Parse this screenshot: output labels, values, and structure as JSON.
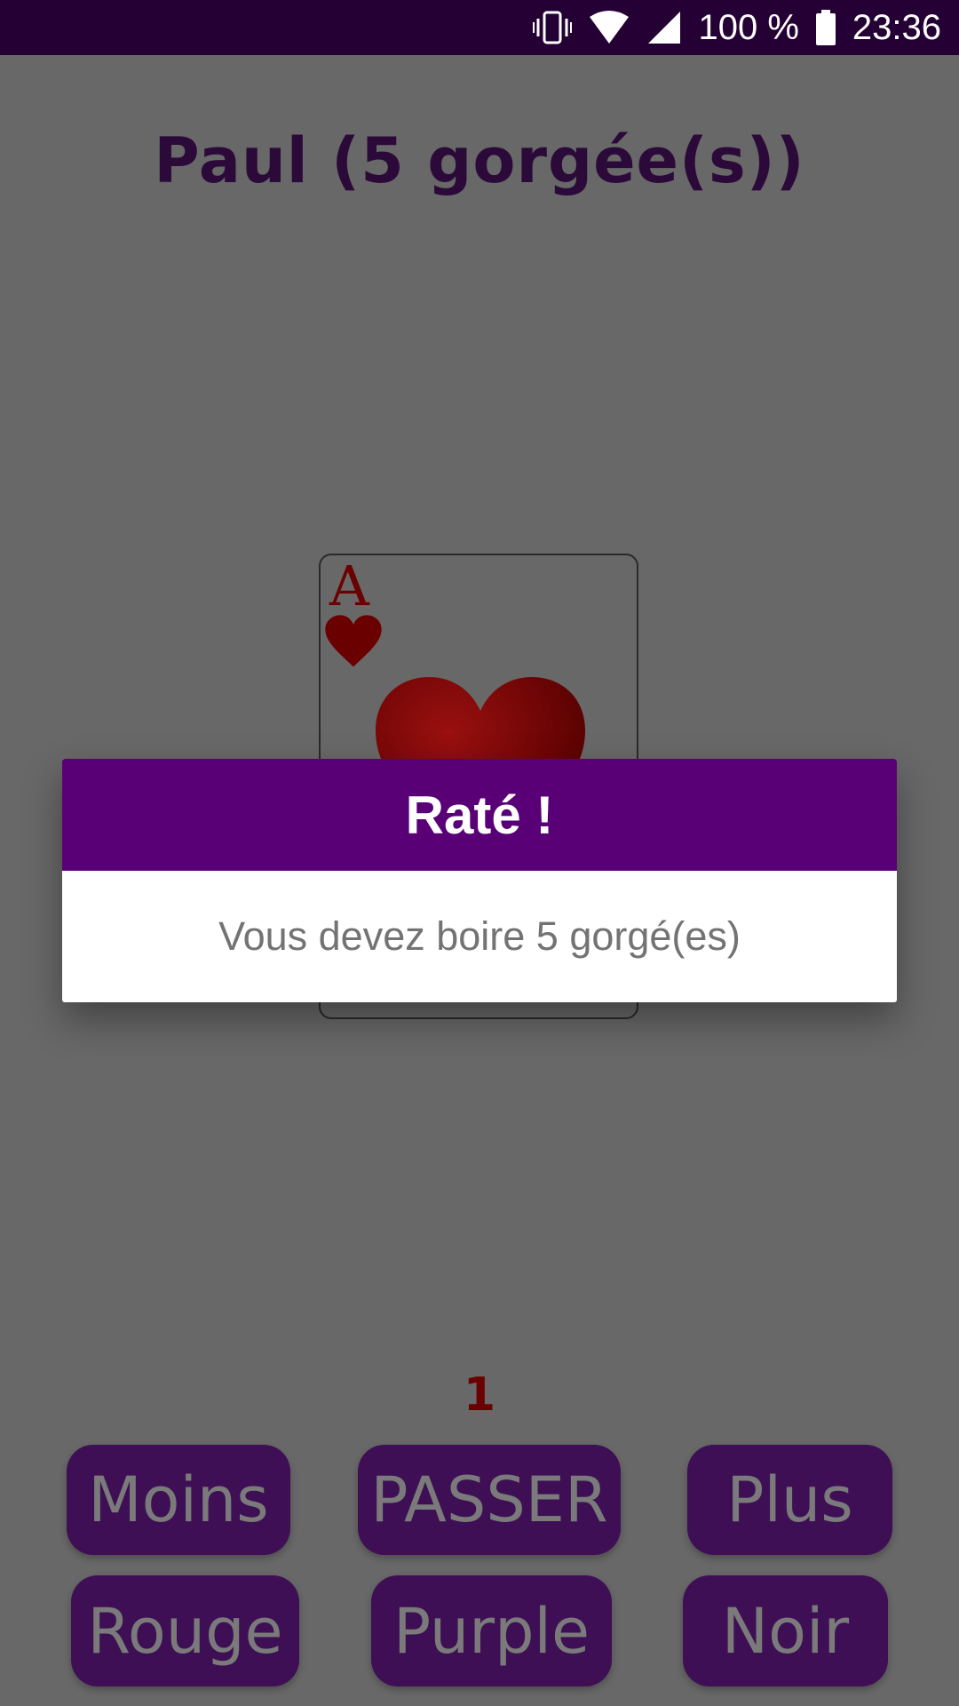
{
  "status_bar": {
    "battery_percent": "100 %",
    "time": "23:36",
    "icons": [
      "vibrate-icon",
      "wifi-icon",
      "cell-signal-icon",
      "battery-icon"
    ]
  },
  "game": {
    "player_title": "Paul (5 gorgée(s))",
    "card": {
      "rank": "A",
      "suit": "hearts",
      "suit_icon": "heart-icon"
    },
    "counter": "1"
  },
  "dialog": {
    "title": "Raté !",
    "message": "Vous devez boire 5 gorgé(es)"
  },
  "buttons": {
    "moins": "Moins",
    "passer": "PASSER",
    "plus": "Plus",
    "rouge": "Rouge",
    "purple": "Purple",
    "noir": "Noir"
  },
  "colors": {
    "status_bar": "#250035",
    "dialog_header": "#5a0077",
    "button_bg": "#3e0f55",
    "card_red": "#6a0000"
  }
}
